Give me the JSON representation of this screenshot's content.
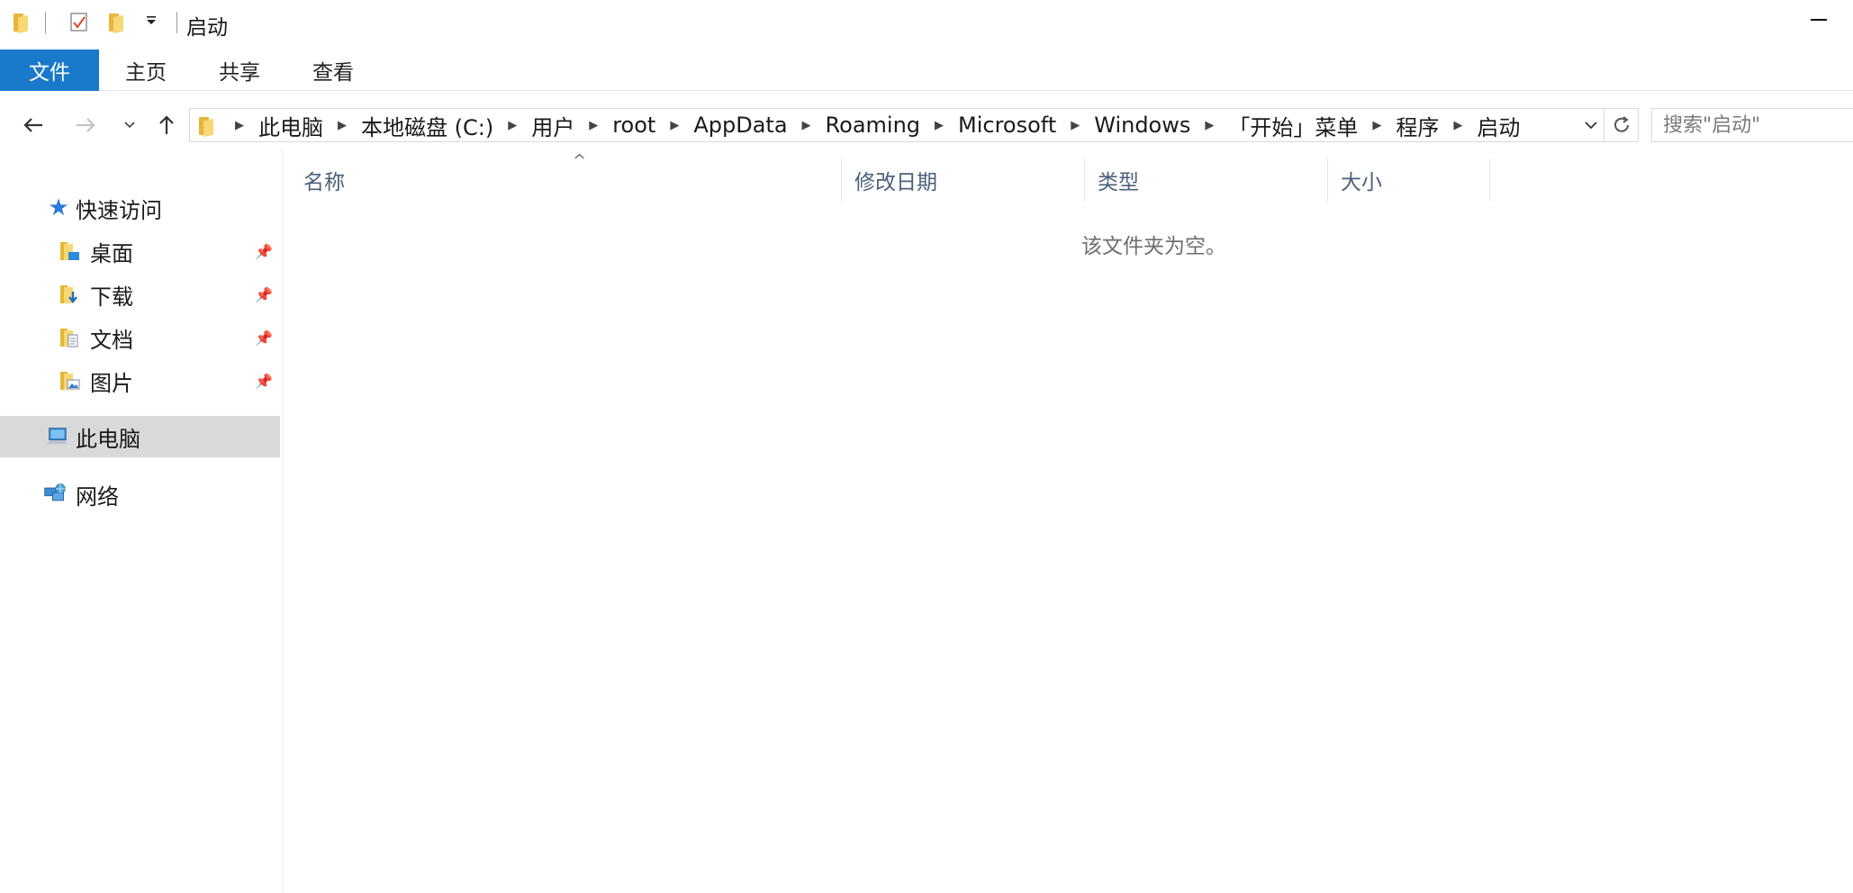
{
  "window": {
    "title": "启动"
  },
  "ribbon": {
    "tabs": [
      {
        "label": "文件"
      },
      {
        "label": "主页"
      },
      {
        "label": "共享"
      },
      {
        "label": "查看"
      }
    ]
  },
  "address": {
    "crumbs": [
      "此电脑",
      "本地磁盘 (C:)",
      "用户",
      "root",
      "AppData",
      "Roaming",
      "Microsoft",
      "Windows",
      "「开始」菜单",
      "程序",
      "启动"
    ]
  },
  "search": {
    "placeholder": "搜索\"启动\""
  },
  "navpane": {
    "quick_access": "快速访问",
    "items": [
      {
        "label": "桌面"
      },
      {
        "label": "下载"
      },
      {
        "label": "文档"
      },
      {
        "label": "图片"
      }
    ],
    "this_pc": "此电脑",
    "network": "网络"
  },
  "content": {
    "columns": [
      "名称",
      "修改日期",
      "类型",
      "大小"
    ],
    "empty_message": "该文件夹为空。"
  },
  "colors": {
    "accent": "#1979ca",
    "selected_bg": "#d9d9d9",
    "folder_yellow": "#f8d775",
    "header_text": "#4c607a"
  }
}
